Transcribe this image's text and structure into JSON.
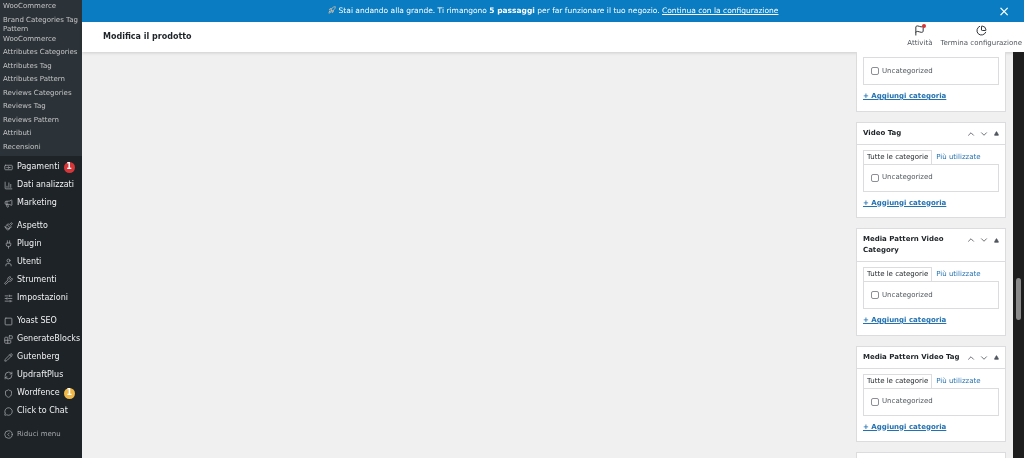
{
  "sidebar": {
    "submenu": [
      {
        "label": "WooCommerce"
      },
      {
        "label": "Brand Categories Tag Pattern WooCommerce"
      },
      {
        "label": "Attributes Categories"
      },
      {
        "label": "Attributes Tag"
      },
      {
        "label": "Attributes Pattern"
      },
      {
        "label": "Reviews Categories"
      },
      {
        "label": "Reviews Tag"
      },
      {
        "label": "Reviews Pattern"
      },
      {
        "label": "Attributi"
      },
      {
        "label": "Recensioni"
      }
    ],
    "menu_groups": [
      [
        {
          "label": "Pagamenti",
          "badge": {
            "text": "1",
            "color": "#d63638"
          }
        },
        {
          "label": "Dati analizzati"
        },
        {
          "label": "Marketing"
        }
      ],
      [
        {
          "label": "Aspetto"
        },
        {
          "label": "Plugin"
        },
        {
          "label": "Utenti"
        },
        {
          "label": "Strumenti"
        },
        {
          "label": "Impostazioni"
        }
      ],
      [
        {
          "label": "Yoast SEO"
        },
        {
          "label": "GenerateBlocks"
        },
        {
          "label": "Gutenberg"
        },
        {
          "label": "UpdraftPlus"
        },
        {
          "label": "Wordfence",
          "badge": {
            "text": "1",
            "color": "#f0b849"
          }
        },
        {
          "label": "Click to Chat"
        }
      ]
    ],
    "collapse": "Riduci menu"
  },
  "notice": {
    "text": "Stai andando alla grande. Ti rimangono **5 passaggi** per far funzionare il tuo negozio.",
    "link": "Continua con la configurazione",
    "close": "×"
  },
  "header": {
    "title": "Modifica il prodotto",
    "actions": [
      {
        "label": "Attività",
        "has_dot": true
      },
      {
        "label": "Termina configurazione",
        "has_dot": false
      }
    ]
  },
  "panels": [
    {
      "kind": "partial",
      "items": [
        {
          "label": "Uncategorized",
          "checked": false
        }
      ],
      "add_link": "+ Aggiungi categoria"
    },
    {
      "kind": "full",
      "title": "Video Tag",
      "tabs": [
        {
          "label": "Tutte le categorie",
          "selected": true
        },
        {
          "label": "Più utilizzate",
          "selected": false
        }
      ],
      "items": [
        {
          "label": "Uncategorized",
          "checked": false
        }
      ],
      "add_link": "+ Aggiungi categoria"
    },
    {
      "kind": "full",
      "title": "Media Pattern Video Category",
      "tabs": [
        {
          "label": "Tutte le categorie",
          "selected": true
        },
        {
          "label": "Più utilizzate",
          "selected": false
        }
      ],
      "items": [
        {
          "label": "Uncategorized",
          "checked": false
        }
      ],
      "add_link": "+ Aggiungi categoria"
    },
    {
      "kind": "full",
      "title": "Media Pattern Video Tag",
      "tabs": [
        {
          "label": "Tutte le categorie",
          "selected": true
        },
        {
          "label": "Più utilizzate",
          "selected": false
        }
      ],
      "items": [
        {
          "label": "Uncategorized",
          "checked": false
        }
      ],
      "add_link": "+ Aggiungi categoria"
    },
    {
      "kind": "cut"
    }
  ]
}
